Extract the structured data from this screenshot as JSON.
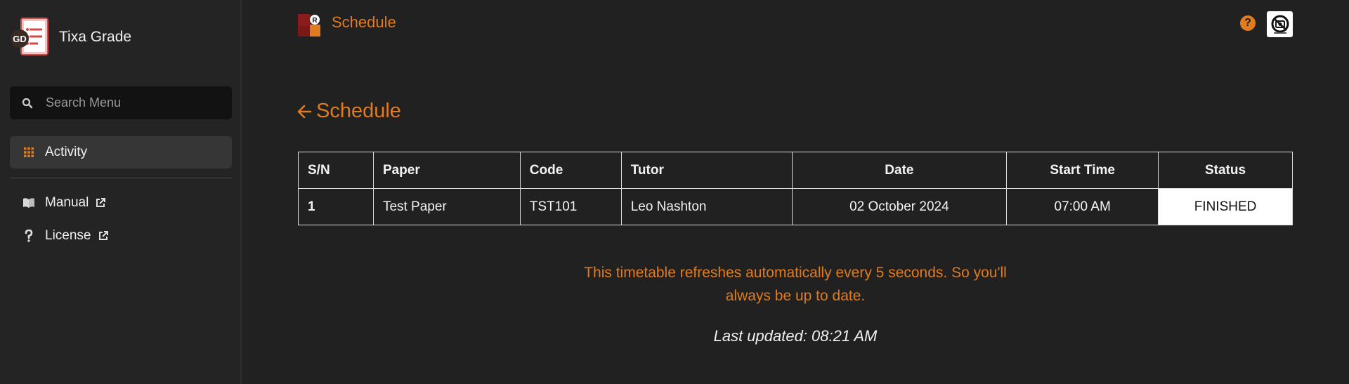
{
  "app": {
    "name": "Tixa Grade",
    "logo_badge": "GD",
    "colors": {
      "accent": "#e07b1f",
      "background": "#212121",
      "sidebar": "#242424"
    }
  },
  "sidebar": {
    "search_placeholder": "Search Menu",
    "items": [
      {
        "label": "Activity",
        "icon": "grid-icon",
        "active": true
      },
      {
        "label": "Manual",
        "icon": "book-icon",
        "external": true
      },
      {
        "label": "License",
        "icon": "question-icon",
        "external": true
      }
    ]
  },
  "topbar": {
    "title": "Schedule",
    "help_label": "?",
    "logo_badge": "R"
  },
  "page": {
    "heading": "Schedule",
    "table": {
      "headers": [
        "S/N",
        "Paper",
        "Code",
        "Tutor",
        "Date",
        "Start Time",
        "Status"
      ],
      "rows": [
        {
          "sn": "1",
          "paper": "Test Paper",
          "code": "TST101",
          "tutor": "Leo Nashton",
          "date": "02 October 2024",
          "start_time": "07:00 AM",
          "status": "FINISHED"
        }
      ]
    },
    "notice_line1": "This timetable refreshes automatically every 5 seconds. So you'll",
    "notice_line2": "always be up to date.",
    "last_updated": "Last updated: 08:21 AM"
  }
}
